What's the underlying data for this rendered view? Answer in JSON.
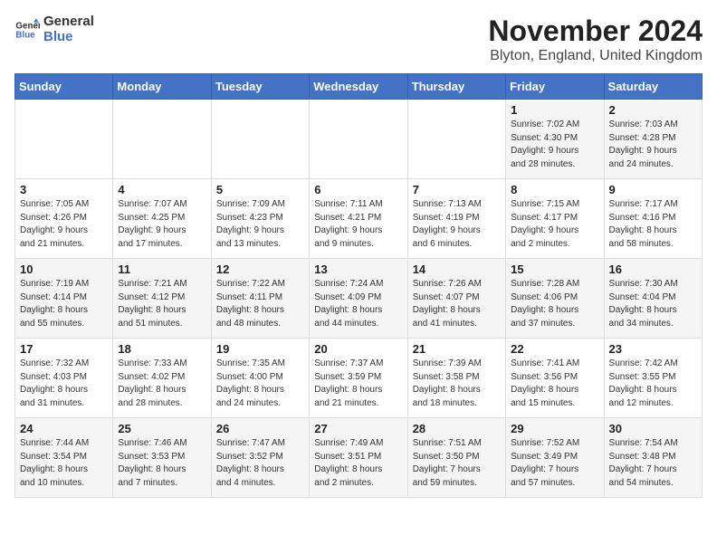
{
  "logo": {
    "line1": "General",
    "line2": "Blue"
  },
  "title": "November 2024",
  "subtitle": "Blyton, England, United Kingdom",
  "days_of_week": [
    "Sunday",
    "Monday",
    "Tuesday",
    "Wednesday",
    "Thursday",
    "Friday",
    "Saturday"
  ],
  "weeks": [
    [
      {
        "day": "",
        "info": ""
      },
      {
        "day": "",
        "info": ""
      },
      {
        "day": "",
        "info": ""
      },
      {
        "day": "",
        "info": ""
      },
      {
        "day": "",
        "info": ""
      },
      {
        "day": "1",
        "info": "Sunrise: 7:02 AM\nSunset: 4:30 PM\nDaylight: 9 hours\nand 28 minutes."
      },
      {
        "day": "2",
        "info": "Sunrise: 7:03 AM\nSunset: 4:28 PM\nDaylight: 9 hours\nand 24 minutes."
      }
    ],
    [
      {
        "day": "3",
        "info": "Sunrise: 7:05 AM\nSunset: 4:26 PM\nDaylight: 9 hours\nand 21 minutes."
      },
      {
        "day": "4",
        "info": "Sunrise: 7:07 AM\nSunset: 4:25 PM\nDaylight: 9 hours\nand 17 minutes."
      },
      {
        "day": "5",
        "info": "Sunrise: 7:09 AM\nSunset: 4:23 PM\nDaylight: 9 hours\nand 13 minutes."
      },
      {
        "day": "6",
        "info": "Sunrise: 7:11 AM\nSunset: 4:21 PM\nDaylight: 9 hours\nand 9 minutes."
      },
      {
        "day": "7",
        "info": "Sunrise: 7:13 AM\nSunset: 4:19 PM\nDaylight: 9 hours\nand 6 minutes."
      },
      {
        "day": "8",
        "info": "Sunrise: 7:15 AM\nSunset: 4:17 PM\nDaylight: 9 hours\nand 2 minutes."
      },
      {
        "day": "9",
        "info": "Sunrise: 7:17 AM\nSunset: 4:16 PM\nDaylight: 8 hours\nand 58 minutes."
      }
    ],
    [
      {
        "day": "10",
        "info": "Sunrise: 7:19 AM\nSunset: 4:14 PM\nDaylight: 8 hours\nand 55 minutes."
      },
      {
        "day": "11",
        "info": "Sunrise: 7:21 AM\nSunset: 4:12 PM\nDaylight: 8 hours\nand 51 minutes."
      },
      {
        "day": "12",
        "info": "Sunrise: 7:22 AM\nSunset: 4:11 PM\nDaylight: 8 hours\nand 48 minutes."
      },
      {
        "day": "13",
        "info": "Sunrise: 7:24 AM\nSunset: 4:09 PM\nDaylight: 8 hours\nand 44 minutes."
      },
      {
        "day": "14",
        "info": "Sunrise: 7:26 AM\nSunset: 4:07 PM\nDaylight: 8 hours\nand 41 minutes."
      },
      {
        "day": "15",
        "info": "Sunrise: 7:28 AM\nSunset: 4:06 PM\nDaylight: 8 hours\nand 37 minutes."
      },
      {
        "day": "16",
        "info": "Sunrise: 7:30 AM\nSunset: 4:04 PM\nDaylight: 8 hours\nand 34 minutes."
      }
    ],
    [
      {
        "day": "17",
        "info": "Sunrise: 7:32 AM\nSunset: 4:03 PM\nDaylight: 8 hours\nand 31 minutes."
      },
      {
        "day": "18",
        "info": "Sunrise: 7:33 AM\nSunset: 4:02 PM\nDaylight: 8 hours\nand 28 minutes."
      },
      {
        "day": "19",
        "info": "Sunrise: 7:35 AM\nSunset: 4:00 PM\nDaylight: 8 hours\nand 24 minutes."
      },
      {
        "day": "20",
        "info": "Sunrise: 7:37 AM\nSunset: 3:59 PM\nDaylight: 8 hours\nand 21 minutes."
      },
      {
        "day": "21",
        "info": "Sunrise: 7:39 AM\nSunset: 3:58 PM\nDaylight: 8 hours\nand 18 minutes."
      },
      {
        "day": "22",
        "info": "Sunrise: 7:41 AM\nSunset: 3:56 PM\nDaylight: 8 hours\nand 15 minutes."
      },
      {
        "day": "23",
        "info": "Sunrise: 7:42 AM\nSunset: 3:55 PM\nDaylight: 8 hours\nand 12 minutes."
      }
    ],
    [
      {
        "day": "24",
        "info": "Sunrise: 7:44 AM\nSunset: 3:54 PM\nDaylight: 8 hours\nand 10 minutes."
      },
      {
        "day": "25",
        "info": "Sunrise: 7:46 AM\nSunset: 3:53 PM\nDaylight: 8 hours\nand 7 minutes."
      },
      {
        "day": "26",
        "info": "Sunrise: 7:47 AM\nSunset: 3:52 PM\nDaylight: 8 hours\nand 4 minutes."
      },
      {
        "day": "27",
        "info": "Sunrise: 7:49 AM\nSunset: 3:51 PM\nDaylight: 8 hours\nand 2 minutes."
      },
      {
        "day": "28",
        "info": "Sunrise: 7:51 AM\nSunset: 3:50 PM\nDaylight: 7 hours\nand 59 minutes."
      },
      {
        "day": "29",
        "info": "Sunrise: 7:52 AM\nSunset: 3:49 PM\nDaylight: 7 hours\nand 57 minutes."
      },
      {
        "day": "30",
        "info": "Sunrise: 7:54 AM\nSunset: 3:48 PM\nDaylight: 7 hours\nand 54 minutes."
      }
    ]
  ]
}
